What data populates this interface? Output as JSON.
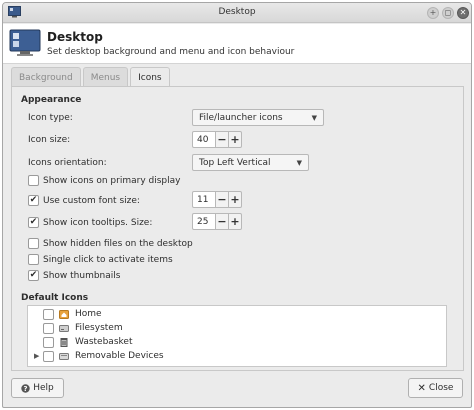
{
  "window": {
    "title": "Desktop",
    "controls": [
      "maximize",
      "restore",
      "close"
    ]
  },
  "header": {
    "title": "Desktop",
    "subtitle": "Set desktop background and menu and icon behaviour"
  },
  "tabs": [
    {
      "label": "Background",
      "active": false
    },
    {
      "label": "Menus",
      "active": false
    },
    {
      "label": "Icons",
      "active": true
    }
  ],
  "appearance": {
    "title": "Appearance",
    "icon_type": {
      "label": "Icon type:",
      "value": "File/launcher icons"
    },
    "icon_size": {
      "label": "Icon size:",
      "value": "40"
    },
    "orientation": {
      "label": "Icons orientation:",
      "value": "Top Left Vertical"
    },
    "show_primary": {
      "label": "Show icons on primary display",
      "checked": false
    },
    "custom_font": {
      "label": "Use custom font size:",
      "checked": true,
      "value": "11"
    },
    "tooltips": {
      "label": "Show icon tooltips. Size:",
      "checked": true,
      "value": "25"
    },
    "hidden_files": {
      "label": "Show hidden files on the desktop",
      "checked": false
    },
    "single_click": {
      "label": "Single click to activate items",
      "checked": false
    },
    "thumbnails": {
      "label": "Show thumbnails",
      "checked": true
    }
  },
  "default_icons": {
    "title": "Default Icons",
    "items": [
      {
        "label": "Home",
        "icon": "home-folder-icon",
        "checked": false,
        "expandable": false
      },
      {
        "label": "Filesystem",
        "icon": "drive-icon",
        "checked": false,
        "expandable": false
      },
      {
        "label": "Wastebasket",
        "icon": "trash-icon",
        "checked": false,
        "expandable": false
      },
      {
        "label": "Removable Devices",
        "icon": "removable-drive-icon",
        "checked": false,
        "expandable": true
      }
    ]
  },
  "buttons": {
    "help": "Help",
    "close": "Close"
  },
  "glyphs": {
    "minus": "−",
    "plus": "+",
    "check": "✔",
    "dropdown": "▼",
    "expander": "▶"
  },
  "colors": {
    "window_bg": "#ebebeb",
    "header_bg": "#ffffff",
    "close_button": "#6e6e6e"
  }
}
